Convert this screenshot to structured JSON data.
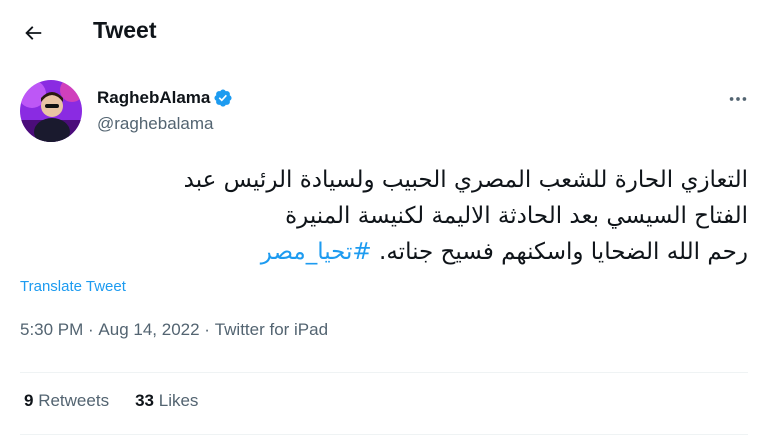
{
  "header": {
    "title": "Tweet",
    "back_icon": "arrow-left-icon"
  },
  "author": {
    "display_name": "RaghebAlama",
    "handle": "@raghebalama",
    "verified_icon": "verified-badge-icon",
    "verified_color": "#1d9bf0",
    "avatar_icon": "avatar"
  },
  "tweet": {
    "line1": "التعازي الحارة للشعب المصري الحبيب ولسيادة الرئيس عبد",
    "line2": "الفتاح السيسي بعد الحادثة الاليمة لكنيسة المنيرة",
    "line3": "رحم الله الضحايا واسكنهم فسيح جناته.",
    "hashtag": "#تحيا_مصر",
    "translate_label": "Translate Tweet"
  },
  "meta": {
    "time": "5:30 PM",
    "separator": " · ",
    "date": "Aug 14, 2022",
    "source": "Twitter for iPad"
  },
  "stats": {
    "retweets_count": "9",
    "retweets_label": "Retweets",
    "likes_count": "33",
    "likes_label": "Likes"
  },
  "colors": {
    "accent": "#1d9bf0",
    "secondary_text": "#536471",
    "divider": "#eff3f4"
  }
}
